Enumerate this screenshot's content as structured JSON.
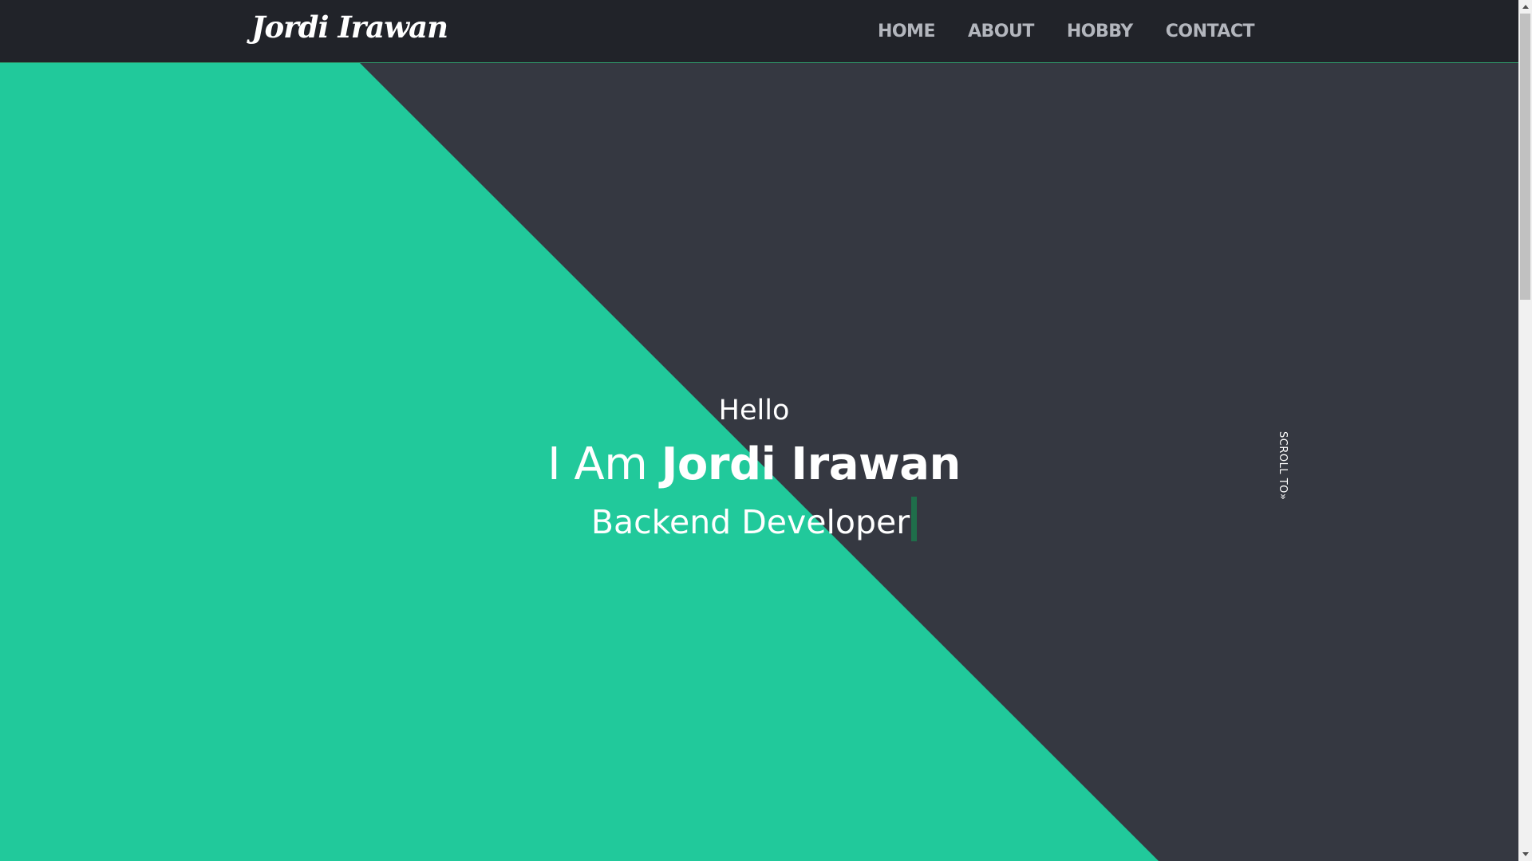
{
  "header": {
    "brand": "Jordi Irawan",
    "nav": [
      {
        "label": "HOME"
      },
      {
        "label": "ABOUT"
      },
      {
        "label": "HOBBY"
      },
      {
        "label": "CONTACT"
      }
    ]
  },
  "hero": {
    "greeting": "Hello",
    "intro_prefix": "I Am ",
    "intro_name": "Jordi Irawan",
    "role": "Backend Developer",
    "scroll_label": "SCROLL TO»"
  },
  "colors": {
    "accent": "#21c99b",
    "dark": "#353841",
    "navbar": "#212329",
    "nav_text": "#b3b6bd",
    "caret": "#1f6e4a"
  }
}
